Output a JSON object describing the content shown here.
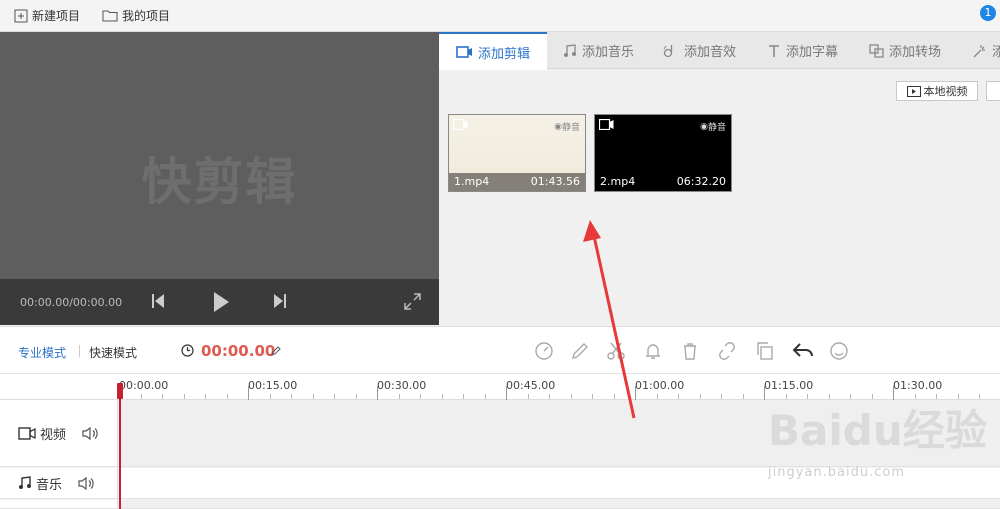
{
  "topbar": {
    "new_project": "新建项目",
    "my_projects": "我的项目",
    "notif_count": "1"
  },
  "preview": {
    "watermark": "快剪辑",
    "time": "00:00.00/00:00.00"
  },
  "library": {
    "tabs": [
      {
        "label": "添加剪辑",
        "icon": "video-camera-icon",
        "active": true
      },
      {
        "label": "添加音乐",
        "icon": "music-note-icon"
      },
      {
        "label": "添加音效",
        "icon": "sound-effect-icon"
      },
      {
        "label": "添加字幕",
        "icon": "text-t-icon"
      },
      {
        "label": "添加转场",
        "icon": "transition-icon"
      },
      {
        "label": "添",
        "icon": "magic-wand-icon"
      }
    ],
    "local_video": "本地视频",
    "clips": [
      {
        "name": "1.mp4",
        "duration": "01:43.56",
        "mute_label": "静音"
      },
      {
        "name": "2.mp4",
        "duration": "06:32.20",
        "mute_label": "静音"
      }
    ]
  },
  "toolbar": {
    "pro_mode": "专业模式",
    "fast_mode": "快速模式",
    "timecode": "00:00.00",
    "icons": [
      "speed-icon",
      "edit-pencil-icon",
      "scissors-icon",
      "bell-icon",
      "trash-icon",
      "unlink-icon",
      "copy-icon",
      "undo-icon",
      "smile-icon"
    ]
  },
  "ruler": {
    "labels": [
      "00:00.00",
      "00:15.00",
      "00:30.00",
      "00:45.00",
      "01:00.00",
      "01:15.00",
      "01:30.00"
    ]
  },
  "tracks": {
    "video": "视频",
    "music": "音乐"
  },
  "watermark_site": {
    "brand": "Baidu经验",
    "url": "jingyan.baidu.com"
  },
  "colors": {
    "accent": "#2a73c8",
    "timecode": "#e05a4f",
    "playhead": "#c8202e",
    "annotation_arrow": "#e8393a"
  }
}
